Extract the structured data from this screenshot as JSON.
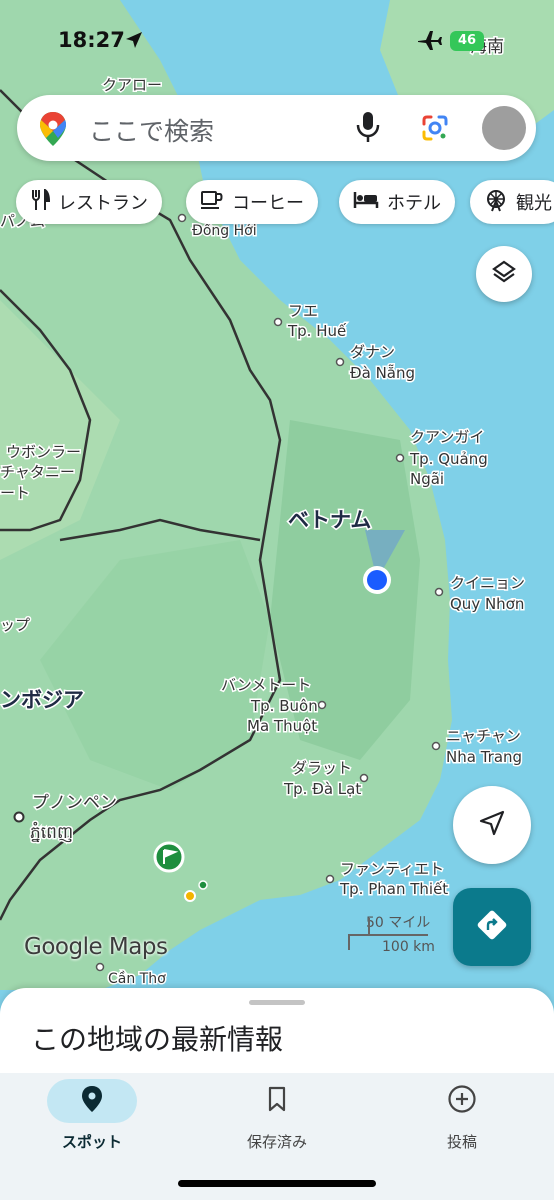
{
  "status_bar": {
    "time": "18:27",
    "battery": "46"
  },
  "search": {
    "placeholder": "ここで検索"
  },
  "chips": [
    {
      "label": "レストラン",
      "icon": "fork-knife-icon"
    },
    {
      "label": "コーヒー",
      "icon": "coffee-cup-icon"
    },
    {
      "label": "ホテル",
      "icon": "bed-icon"
    },
    {
      "label": "観光",
      "icon": "ferris-wheel-icon"
    }
  ],
  "map_labels": {
    "hainan": "海南",
    "quaro": "クアロー",
    "panom": "パノム",
    "dong_hoi": "Đồng Hới",
    "hue_ja": "フエ",
    "hue": "Tp. Huế",
    "danang_ja": "ダナン",
    "danang": "Đà Nẵng",
    "quang_ngai_ja": "クアンガイ",
    "quang_ngai_1": "Tp. Quảng",
    "quang_ngai_2": "Ngãi",
    "vietnam": "ベトナム",
    "ubon": "ウボンラー",
    "chatani": "チャタニー",
    "to": "ート",
    "quy_nhon_ja": "クイニョン",
    "quy_nhon": "Quy Nhơn",
    "pp": "ップ",
    "cambodia": "ンボジア",
    "bmt_ja": "バンメトート",
    "bmt_1": "Tp. Buôn",
    "bmt_2": "Ma Thuột",
    "nha_trang_ja": "ニャチャン",
    "nha_trang": "Nha Trang",
    "dalat_ja": "ダラット",
    "dalat": "Tp. Đà Lạt",
    "phnom_penh_ja": "プノンペン",
    "phnom_penh_km": "ភ្នំពេញ",
    "phan_thiet_ja": "ファンティエト",
    "phan_thiet": "Tp. Phan Thiết",
    "can_tho": "Cần Thơ"
  },
  "scale": {
    "miles": "50 マイル",
    "km": "100 km"
  },
  "logo": "Google Maps",
  "sheet": {
    "title": "この地域の最新情報"
  },
  "nav": [
    {
      "label": "スポット",
      "icon": "place-pin-icon"
    },
    {
      "label": "保存済み",
      "icon": "bookmark-icon"
    },
    {
      "label": "投稿",
      "icon": "add-circle-icon"
    }
  ],
  "colors": {
    "sea": "#7fd0e8",
    "land": "#9fd7ad",
    "accent": "#0b7a8c",
    "location": "#1a73e8"
  }
}
